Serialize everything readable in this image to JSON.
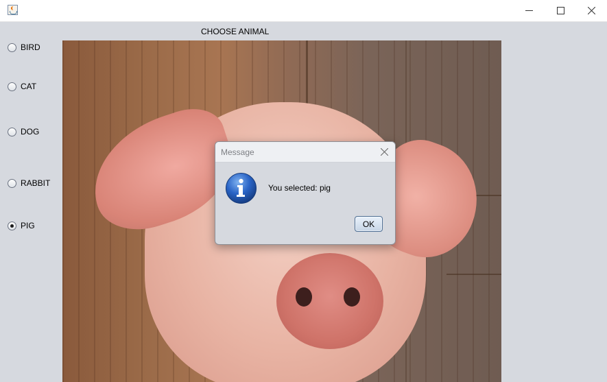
{
  "window": {
    "icon": "java-cup-icon",
    "controls": [
      "minimize-icon",
      "maximize-icon",
      "close-icon"
    ]
  },
  "panel": {
    "heading": "CHOOSE ANIMAL",
    "options": [
      {
        "label": "BIRD",
        "selected": false
      },
      {
        "label": "CAT",
        "selected": false
      },
      {
        "label": "DOG",
        "selected": false
      },
      {
        "label": "RABBIT",
        "selected": false
      },
      {
        "label": "PIG",
        "selected": true
      }
    ],
    "image": "pig-photo"
  },
  "dialog": {
    "title": "Message",
    "icon": "info-icon",
    "message": "You selected: pig",
    "ok_label": "OK"
  },
  "colors": {
    "window_bg": "#d6d9df",
    "info_icon_blue": "#1f56b4"
  }
}
